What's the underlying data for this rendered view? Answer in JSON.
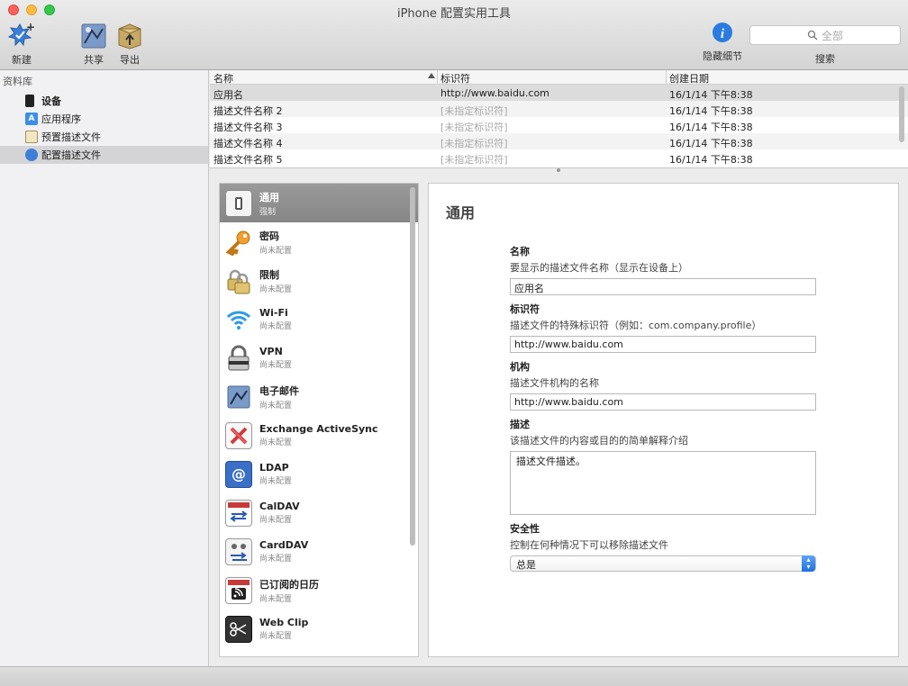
{
  "window": {
    "title": "iPhone 配置实用工具"
  },
  "toolbar": {
    "new_label": "新建",
    "share_label": "共享",
    "export_label": "导出",
    "info_label": "隐藏细节",
    "search_placeholder": "全部",
    "search_label": "搜索"
  },
  "sidebar": {
    "header": "资料库",
    "items": [
      {
        "label": "设备",
        "icon": "iphone-icon"
      },
      {
        "label": "应用程序",
        "icon": "app-store-icon"
      },
      {
        "label": "预置描述文件",
        "icon": "provisioning-profile-icon"
      },
      {
        "label": "配置描述文件",
        "icon": "configuration-profile-icon",
        "selected": true
      }
    ]
  },
  "profiles_table": {
    "columns": [
      "名称",
      "标识符",
      "创建日期"
    ],
    "rows": [
      {
        "name": "应用名",
        "identifier": "http://www.baidu.com",
        "date": "16/1/14 下午8:38",
        "selected": true
      },
      {
        "name": "描述文件名称 2",
        "identifier": "[未指定标识符]",
        "date": "16/1/14 下午8:38"
      },
      {
        "name": "描述文件名称 3",
        "identifier": "[未指定标识符]",
        "date": "16/1/14 下午8:38"
      },
      {
        "name": "描述文件名称 4",
        "identifier": "[未指定标识符]",
        "date": "16/1/14 下午8:38"
      },
      {
        "name": "描述文件名称 5",
        "identifier": "[未指定标识符]",
        "date": "16/1/14 下午8:38"
      }
    ]
  },
  "payloads": [
    {
      "name": "通用",
      "status": "强制",
      "icon": "general-switch-icon",
      "selected": true
    },
    {
      "name": "密码",
      "status": "尚未配置",
      "icon": "key-icon"
    },
    {
      "name": "限制",
      "status": "尚未配置",
      "icon": "padlocks-icon"
    },
    {
      "name": "Wi-Fi",
      "status": "尚未配置",
      "icon": "wifi-icon"
    },
    {
      "name": "VPN",
      "status": "尚未配置",
      "icon": "vpn-lock-icon"
    },
    {
      "name": "电子邮件",
      "status": "尚未配置",
      "icon": "mail-stamp-icon"
    },
    {
      "name": "Exchange ActiveSync",
      "status": "尚未配置",
      "icon": "exchange-icon"
    },
    {
      "name": "LDAP",
      "status": "尚未配置",
      "icon": "ldap-address-book-icon"
    },
    {
      "name": "CalDAV",
      "status": "尚未配置",
      "icon": "caldav-calendar-icon"
    },
    {
      "name": "CardDAV",
      "status": "尚未配置",
      "icon": "carddav-contacts-icon"
    },
    {
      "name": "已订阅的日历",
      "status": "尚未配置",
      "icon": "subscribed-calendar-icon"
    },
    {
      "name": "Web Clip",
      "status": "尚未配置",
      "icon": "web-clip-icon"
    }
  ],
  "detail": {
    "title": "通用",
    "name_label": "名称",
    "name_desc": "要显示的描述文件名称（显示在设备上）",
    "name_value": "应用名",
    "identifier_label": "标识符",
    "identifier_desc": "描述文件的特殊标识符（例如：com.company.profile）",
    "identifier_value": "http://www.baidu.com",
    "org_label": "机构",
    "org_desc": "描述文件机构的名称",
    "org_value": "http://www.baidu.com",
    "description_label": "描述",
    "description_desc": "该描述文件的内容或目的的简单解释介绍",
    "description_value": "描述文件描述。",
    "security_label": "安全性",
    "security_desc": "控制在何种情况下可以移除描述文件",
    "security_value": "总是"
  },
  "colors": {
    "selected_row": "#dcdcdc",
    "selected_payload": "#8f8f8f",
    "info_blue": "#2b7be0"
  }
}
